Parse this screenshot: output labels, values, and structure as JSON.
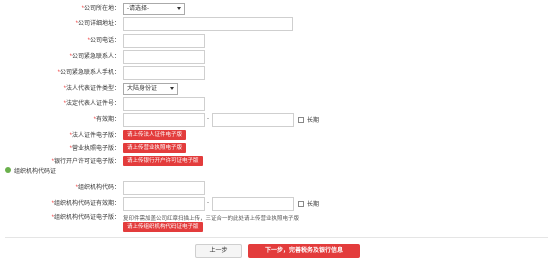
{
  "form": {
    "company_location": {
      "label": "公司所在地",
      "value": "-请选择-"
    },
    "company_address": {
      "label": "公司详细地址",
      "value": ""
    },
    "company_phone": {
      "label": "公司电话",
      "value": ""
    },
    "emergency_contact": {
      "label": "公司紧急联系人",
      "value": ""
    },
    "emergency_mobile": {
      "label": "公司紧急联系人手机",
      "value": ""
    },
    "id_type": {
      "label": "法人代表证件类型",
      "value": "大陆身份证"
    },
    "id_number": {
      "label": "法定代表人证件号",
      "value": ""
    },
    "validity": {
      "label": "有效期",
      "start": "",
      "end": "",
      "separator": "-",
      "long_term_label": "长期"
    },
    "id_image": {
      "label": "法人证件电子版",
      "button": "请上传法人证件电子版"
    },
    "license_image": {
      "label": "营业执照电子版",
      "button": "请上传营业执照电子版"
    },
    "bank_permit_image": {
      "label": "银行开户许可证电子版",
      "button": "请上传银行开户许可证电子版"
    }
  },
  "org_section": {
    "title": "组织机构代码证",
    "org_code": {
      "label": "组织机构代码",
      "value": ""
    },
    "org_validity": {
      "label": "组织机构代码证有效期",
      "start": "",
      "end": "",
      "separator": "-",
      "long_term_label": "长期"
    },
    "org_image": {
      "label": "组织机构代码证电子版",
      "note": "复印件需加盖公司红章扫描上传，三证合一的此处请上传营业执照电子版",
      "button": "请上传组织机构代码证电子版"
    }
  },
  "required_mark": "*",
  "label_suffix": "：",
  "actions": {
    "prev": "上一步",
    "next": "下一步，完善税务及银行信息"
  },
  "colors": {
    "accent": "#e33c3c",
    "section_dot": "#6ab04c"
  }
}
